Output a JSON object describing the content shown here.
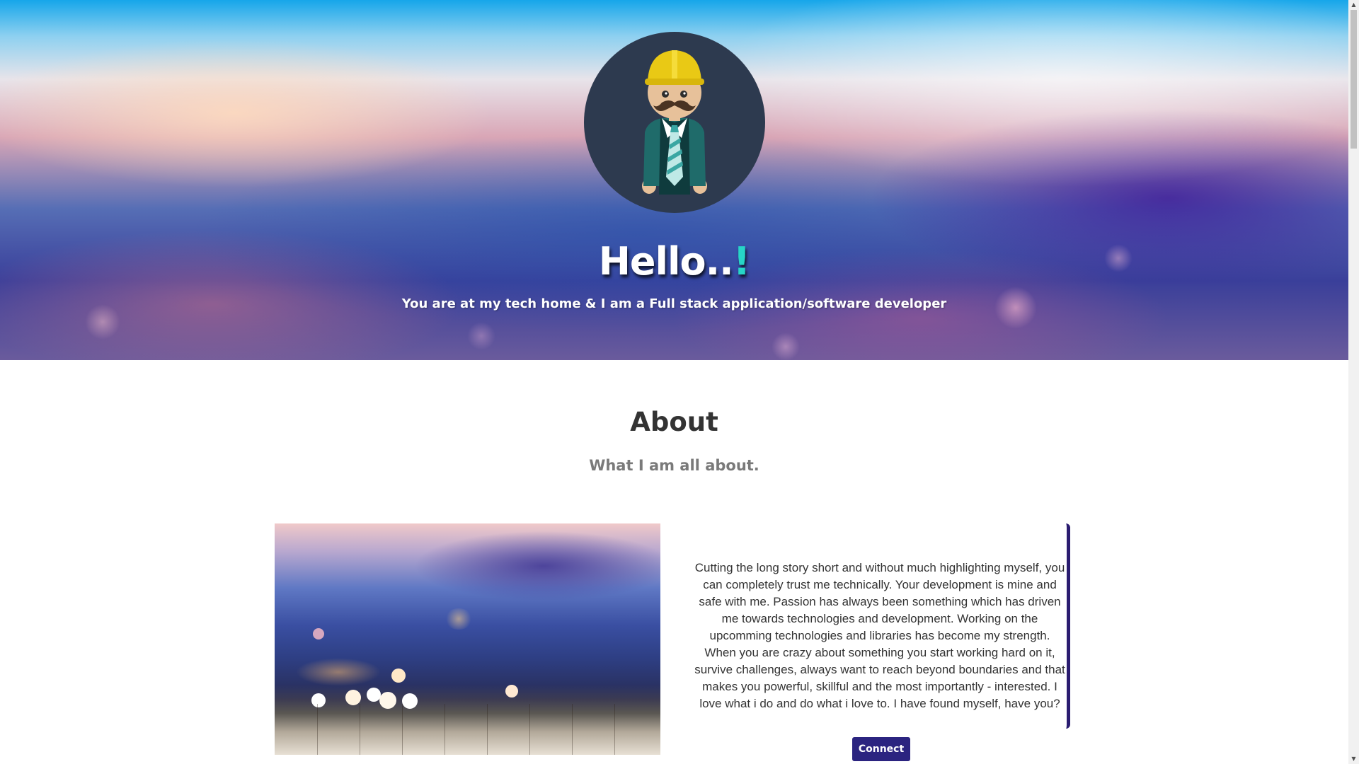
{
  "hero": {
    "title_main": "Hello..",
    "title_accent": "!",
    "subtitle": "You are at my tech home & I am a Full stack application/software developer",
    "accent_color": "#27d5c7",
    "avatar_icon": "developer-avatar-icon"
  },
  "about": {
    "title": "About",
    "subtitle": "What I am all about.",
    "text": "Cutting the long story short and without much highlighting myself, you can completely trust me technically. Your development is mine and safe with me. Passion has always been something which has driven me towards technologies and development. Working on the upcomming technologies and libraries has become my strength. When you are crazy about something you start working hard on it, survive challenges, always want to reach beyond boundaries and that makes you powerful, skillful and the most importantly - interested. I love what i do and do what i love to. I have found myself, have you?",
    "connect_label": "Connect",
    "button_color": "#2b2480",
    "card_border_color": "#2a1c70"
  },
  "scrollbar": {
    "up_arrow": "▲",
    "down_arrow": "▼"
  }
}
